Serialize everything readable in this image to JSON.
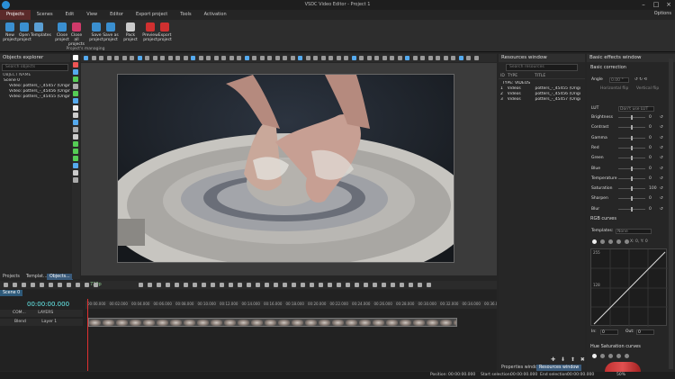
{
  "window": {
    "title": "VSDC Video Editor - Project 1",
    "minimize": "–",
    "maximize": "□",
    "close": "×"
  },
  "menu": [
    {
      "label": "Projects",
      "active": true
    },
    {
      "label": "Scenes"
    },
    {
      "label": "Edit"
    },
    {
      "label": "View"
    },
    {
      "label": "Editor"
    },
    {
      "label": "Export project"
    },
    {
      "label": "Tools"
    },
    {
      "label": "Activation"
    }
  ],
  "options_label": "Options",
  "ribbon": {
    "buttons": [
      {
        "label": "New\nproject",
        "icon": "new-project-icon",
        "color": "#3a8fd0"
      },
      {
        "label": "Open\nproject",
        "icon": "open-project-icon",
        "color": "#3a8fd0"
      },
      {
        "label": "Templates",
        "icon": "templates-icon",
        "color": "#5a9fd4"
      },
      {
        "label": "Close\nproject",
        "icon": "close-project-icon",
        "color": "#3a8fd0"
      },
      {
        "label": "Close all\nprojects",
        "icon": "close-all-icon",
        "color": "#d03a6a"
      },
      {
        "label": "Save\nproject",
        "icon": "save-project-icon",
        "color": "#3a8fd0"
      },
      {
        "label": "Save as\nproject",
        "icon": "save-as-icon",
        "color": "#3a8fd0"
      },
      {
        "label": "Pack\nproject",
        "icon": "pack-project-icon",
        "color": "#cccccc"
      },
      {
        "label": "Preview\nproject",
        "icon": "preview-icon",
        "color": "#d03030"
      },
      {
        "label": "Export\nproject",
        "icon": "export-icon",
        "color": "#d03030"
      }
    ],
    "group_label": "Project's managing"
  },
  "objects_explorer": {
    "title": "Objects explorer",
    "search_placeholder": "Search objects",
    "column": "OBJECT NAME",
    "items": [
      "Scene 0",
      "Video: potters_-_45457 (Origin",
      "Video: potters_-_45456 (Origin",
      "Video: potters_-_45455 (Origin"
    ],
    "bottom_tabs": [
      "Projects",
      "Templat...",
      "Objects..."
    ]
  },
  "resources": {
    "title": "Resources window",
    "search_placeholder": "Search resources",
    "columns": [
      "ID",
      "TYPE",
      "TITLE"
    ],
    "group": "TYPE: VIDEOS",
    "rows": [
      {
        "id": "1",
        "type": "Videos",
        "title": "potters_-_45455 (Origi"
      },
      {
        "id": "2",
        "type": "Videos",
        "title": "potters_-_45456 (Origi"
      },
      {
        "id": "3",
        "type": "Videos",
        "title": "potters_-_45457 (Origi"
      }
    ],
    "bottom_tabs": [
      "Properties window",
      "Resources window"
    ]
  },
  "effects": {
    "title": "Basic effects window",
    "correction_label": "Basic correction",
    "angle_label": "Angle",
    "angle_value": "0.00 °",
    "flip_h": "Horizontal flip",
    "flip_v": "Vertical flip",
    "lut_label": "LUT",
    "lut_value": "Don't use LUT",
    "adjustments": [
      {
        "label": "Brightness",
        "value": "0"
      },
      {
        "label": "Contrast",
        "value": "0"
      },
      {
        "label": "Gamma",
        "value": "0"
      },
      {
        "label": "Red",
        "value": "0"
      },
      {
        "label": "Green",
        "value": "0"
      },
      {
        "label": "Blue",
        "value": "0"
      },
      {
        "label": "Temperature",
        "value": "0"
      },
      {
        "label": "Saturation",
        "value": "100"
      },
      {
        "label": "Sharpen",
        "value": "0"
      },
      {
        "label": "Blur",
        "value": "0"
      }
    ],
    "rgb_label": "RGB curves",
    "templates_label": "Templates:",
    "templates_value": "None",
    "curve_coords": "X: 0, Y: 0",
    "curve_top": "255",
    "curve_mid": "128",
    "in_label": "In:",
    "in_value": "0",
    "out_label": "Out:",
    "out_value": "0",
    "hue_label": "Hue Saturation curves"
  },
  "timeline": {
    "scene_tab": "Scene 0",
    "timecode": "00:00:00.000",
    "zoom": "720p",
    "com_label": "COM...",
    "layers_label": "LAYERS",
    "blend_label": "Blend",
    "layer_label": "Layer 1",
    "ruler": [
      "00:00.000",
      "00:02.000",
      "00:04.000",
      "00:06.000",
      "00:08.000",
      "00:10.000",
      "00:12.000",
      "00:14.000",
      "00:16.000",
      "00:18.000",
      "00:20.000",
      "00:22.000",
      "00:24.000",
      "00:26.000",
      "00:28.000",
      "00:30.000",
      "00:32.000",
      "00:34.000",
      "00:36.000",
      "00:38.000"
    ]
  },
  "status": {
    "position_label": "Position:",
    "position_value": "00:00:00.000",
    "start_label": "Start selection:",
    "start_value": "00:00:00.000",
    "end_label": "End selection:",
    "end_value": "00:00:00.000",
    "zoom": "50%"
  }
}
